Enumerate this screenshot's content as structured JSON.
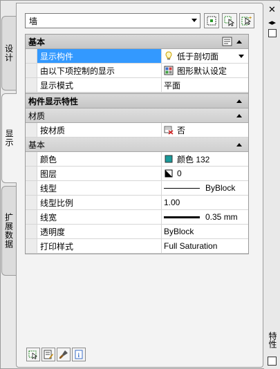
{
  "left_tabs": [
    "设计",
    "显示",
    "扩展数据"
  ],
  "object_type": "墙",
  "toolbar": {
    "quick_select_icon": "quick-select-icon",
    "select_objects_icon": "select-objects-icon",
    "toggle_pickadd_icon": "toggle-pickadd-icon"
  },
  "sections": {
    "basic": {
      "label": "基本",
      "rows": [
        {
          "name": "显示构件",
          "value": "低于剖切面"
        },
        {
          "name": "由以下项控制的显示",
          "value": "图形默认设定"
        },
        {
          "name": "显示模式",
          "value": "平面"
        }
      ]
    },
    "component_props": {
      "label": "构件显示特性",
      "material": {
        "label": "材质",
        "rows": [
          {
            "name": "按材质",
            "value": "否"
          }
        ]
      },
      "basic": {
        "label": "基本",
        "rows": [
          {
            "name": "颜色",
            "value": "颜色 132"
          },
          {
            "name": "图层",
            "value": "0"
          },
          {
            "name": "线型",
            "value": "ByBlock"
          },
          {
            "name": "线型比例",
            "value": "1.00"
          },
          {
            "name": "线宽",
            "value": "0.35 mm"
          },
          {
            "name": "透明度",
            "value": "ByBlock"
          },
          {
            "name": "打印样式",
            "value": "Full Saturation"
          }
        ]
      }
    }
  },
  "right_strip": {
    "title": "特性"
  },
  "colors": {
    "selection": "#3399ff",
    "color132": "#1a9a9a"
  }
}
